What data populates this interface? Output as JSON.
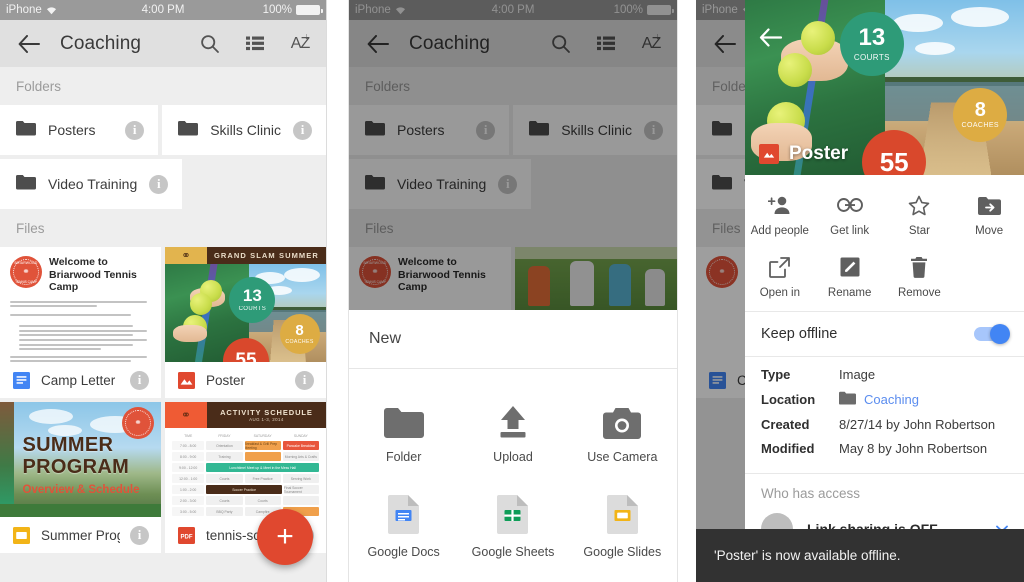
{
  "status_bar": {
    "carrier": "iPhone",
    "time": "4:00 PM",
    "battery": "100%"
  },
  "app_bar": {
    "title": "Coaching",
    "back_icon": "arrow-left-icon",
    "search_icon": "search-icon",
    "list_view_icon": "list-view-icon",
    "sort_label": "AZ",
    "sort_icon": "sort-az-icon"
  },
  "sections": {
    "folders_label": "Folders",
    "files_label": "Files"
  },
  "folders": [
    {
      "name": "Posters",
      "info": "i"
    },
    {
      "name": "Skills Clinic",
      "info": "i"
    },
    {
      "name": "Video Training",
      "info": "i"
    }
  ],
  "files": [
    {
      "name": "Camp Letter",
      "type": "doc",
      "info": "i"
    },
    {
      "name": "Poster",
      "type": "image",
      "info": "i"
    },
    {
      "name": "Summer Progr…",
      "type": "slides",
      "info": "i"
    },
    {
      "name": "tennis-sched…",
      "type": "pdf",
      "badge": "PDF",
      "info": "i"
    }
  ],
  "camp_letter": {
    "title": "Welcome to Briarwood Tennis Camp",
    "seal_top": "BRIARWOOD",
    "seal_bottom": "TENNIS CAMP"
  },
  "poster": {
    "banner": "GRAND SLAM SUMMER",
    "badges": [
      {
        "number": "13",
        "label": "COURTS",
        "color": "#2e9b78"
      },
      {
        "number": "8",
        "label": "COACHES",
        "color": "#ddac43"
      },
      {
        "number": "55",
        "label": "",
        "color": "#d9482c"
      }
    ]
  },
  "summer_program": {
    "title_line1": "SUMMER",
    "title_line2": "PROGRAM",
    "subtitle": "Overview & Schedule"
  },
  "schedule": {
    "title": "ACTIVITY SCHEDULE",
    "subtitle": "AUG 1-3, 2014",
    "columns": [
      "TIME",
      "FRIDAY",
      "SATURDAY",
      "SUNDAY"
    ],
    "rows": [
      {
        "time": "7:00 - 8:00",
        "cells": [
          "Orientation",
          "Breakfast & Grill Prep Meeting",
          "Pancake Breakfast"
        ]
      },
      {
        "time": "8:00 - 9:00",
        "cells": [
          "Training",
          "",
          "Morning Arts & Crafts"
        ]
      },
      {
        "time": "9:00 - 12:00",
        "cells": [
          "Lunchtime! Meet up & Meet in the Mess Hall"
        ]
      },
      {
        "time": "12:00 - 1:00",
        "cells": [
          "Courts",
          "Free Practice",
          "Serving Work"
        ]
      },
      {
        "time": "1:00 - 2:00",
        "cells": [
          "Soccer Practice",
          "Final Soccer Tournament"
        ]
      },
      {
        "time": "2:00 - 3:00",
        "cells": [
          "Courts",
          "Courts",
          ""
        ]
      },
      {
        "time": "3:00 - 5:00",
        "cells": [
          "BBQ Party",
          "Campfire",
          ""
        ]
      }
    ]
  },
  "fab": {
    "label": "+",
    "icon": "add-icon",
    "color": "#e0482f"
  },
  "new_sheet": {
    "title": "New",
    "items": [
      {
        "label": "Folder",
        "icon": "folder-icon"
      },
      {
        "label": "Upload",
        "icon": "upload-icon"
      },
      {
        "label": "Use Camera",
        "icon": "camera-icon"
      },
      {
        "label": "Google Docs",
        "icon": "google-docs-icon"
      },
      {
        "label": "Google Sheets",
        "icon": "google-sheets-icon"
      },
      {
        "label": "Google Slides",
        "icon": "google-slides-icon"
      }
    ]
  },
  "detail": {
    "hero_title": "Poster",
    "hero_back_icon": "arrow-left-icon",
    "file_type_icon": "image-file-icon",
    "actions": [
      {
        "label": "Add people",
        "icon": "person-add-icon"
      },
      {
        "label": "Get link",
        "icon": "link-icon"
      },
      {
        "label": "Star",
        "icon": "star-outline-icon"
      },
      {
        "label": "Move",
        "icon": "move-folder-icon"
      },
      {
        "label": "Open in",
        "icon": "open-in-new-icon"
      },
      {
        "label": "Rename",
        "icon": "rename-pencil-icon"
      },
      {
        "label": "Remove",
        "icon": "trash-icon"
      }
    ],
    "keep_offline": {
      "label": "Keep offline",
      "state": "on",
      "accent": "#4285f4"
    },
    "metadata": [
      {
        "key": "Type",
        "value": "Image"
      },
      {
        "key": "Location",
        "value": "Coaching",
        "is_link": true,
        "icon": "folder-icon"
      },
      {
        "key": "Created",
        "value": "8/27/14 by John Robertson"
      },
      {
        "key": "Modified",
        "value": "May 8 by John Robertson"
      }
    ],
    "access_title": "Who has access",
    "access_row": "Link sharing is OFF"
  },
  "snackbar": {
    "message": "'Poster' is now available offline."
  }
}
